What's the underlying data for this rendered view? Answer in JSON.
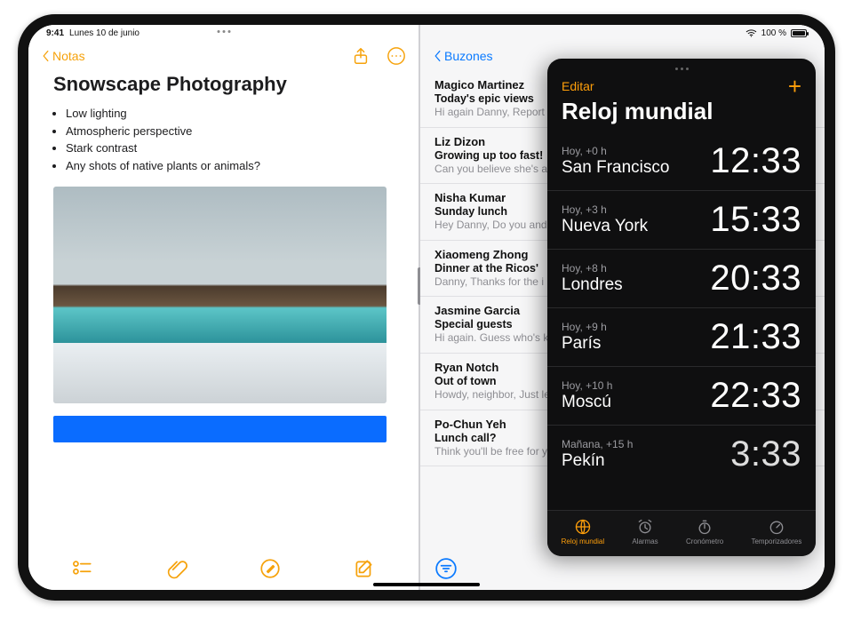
{
  "status": {
    "time": "9:41",
    "date": "Lunes 10 de junio",
    "battery_text": "100 %"
  },
  "notes": {
    "back_label": "Notas",
    "title": "Snowscape Photography",
    "bullets": [
      "Low lighting",
      "Atmospheric perspective",
      "Stark contrast",
      "Any shots of native plants or animals?"
    ]
  },
  "mail": {
    "back_label": "Buzones",
    "items": [
      {
        "from": "Magico Martinez",
        "subject": "Today's epic views",
        "preview": "Hi again Danny, Report\nWide open skies, a gen"
      },
      {
        "from": "Liz Dizon",
        "subject": "Growing up too fast!",
        "preview": "Can you believe she's a"
      },
      {
        "from": "Nisha Kumar",
        "subject": "Sunday lunch",
        "preview": "Hey Danny, Do you and\ndad? If you two join, th"
      },
      {
        "from": "Xiaomeng Zhong",
        "subject": "Dinner at the Ricos'",
        "preview": "Danny, Thanks for the i\nremembered to take on"
      },
      {
        "from": "Jasmine Garcia",
        "subject": "Special guests",
        "preview": "Hi again. Guess who's\nknow how to make me"
      },
      {
        "from": "Ryan Notch",
        "subject": "Out of town",
        "preview": "Howdy, neighbor, Just\nleaving Tuesday and wi"
      },
      {
        "from": "Po-Chun Yeh",
        "subject": "Lunch call?",
        "preview": "Think you'll be free for\nyou think might work a"
      }
    ]
  },
  "clock": {
    "edit_label": "Editar",
    "title": "Reloj mundial",
    "rows": [
      {
        "offset": "Hoy, +0 h",
        "city": "San Francisco",
        "time": "12:33"
      },
      {
        "offset": "Hoy, +3 h",
        "city": "Nueva York",
        "time": "15:33"
      },
      {
        "offset": "Hoy, +8 h",
        "city": "Londres",
        "time": "20:33"
      },
      {
        "offset": "Hoy, +9 h",
        "city": "París",
        "time": "21:33"
      },
      {
        "offset": "Hoy, +10 h",
        "city": "Moscú",
        "time": "22:33"
      },
      {
        "offset": "Mañana, +15 h",
        "city": "Pekín",
        "time": "3:33"
      }
    ],
    "tabs": [
      {
        "id": "world",
        "label": "Reloj mundial",
        "active": true
      },
      {
        "id": "alarm",
        "label": "Alarmas",
        "active": false
      },
      {
        "id": "stopwatch",
        "label": "Cronómetro",
        "active": false
      },
      {
        "id": "timer",
        "label": "Temporizadores",
        "active": false
      }
    ]
  }
}
